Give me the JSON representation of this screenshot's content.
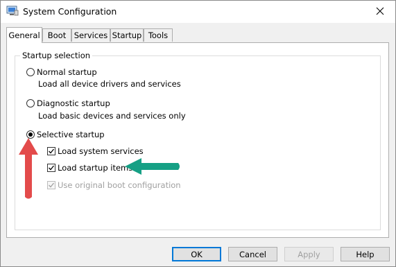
{
  "window": {
    "title": "System Configuration",
    "icon": "system-config-icon",
    "close_glyph": "✕"
  },
  "tabs": [
    {
      "label": "General",
      "active": true
    },
    {
      "label": "Boot",
      "active": false
    },
    {
      "label": "Services",
      "active": false
    },
    {
      "label": "Startup",
      "active": false
    },
    {
      "label": "Tools",
      "active": false
    }
  ],
  "startup_selection": {
    "legend": "Startup selection",
    "options": [
      {
        "label": "Normal startup",
        "description": "Load all device drivers and services",
        "selected": false
      },
      {
        "label": "Diagnostic startup",
        "description": "Load basic devices and services only",
        "selected": false
      },
      {
        "label": "Selective startup",
        "description": "",
        "selected": true
      }
    ],
    "selective_options": [
      {
        "label": "Load system services",
        "checked": true,
        "enabled": true
      },
      {
        "label": "Load startup items",
        "checked": true,
        "enabled": true
      },
      {
        "label": "Use original boot configuration",
        "checked": true,
        "enabled": false
      }
    ]
  },
  "buttons": {
    "ok": "OK",
    "cancel": "Cancel",
    "apply": "Apply",
    "help": "Help"
  },
  "colors": {
    "red_arrow": "#e34b4b",
    "green_arrow": "#16a085",
    "focus_border": "#0078d7"
  }
}
